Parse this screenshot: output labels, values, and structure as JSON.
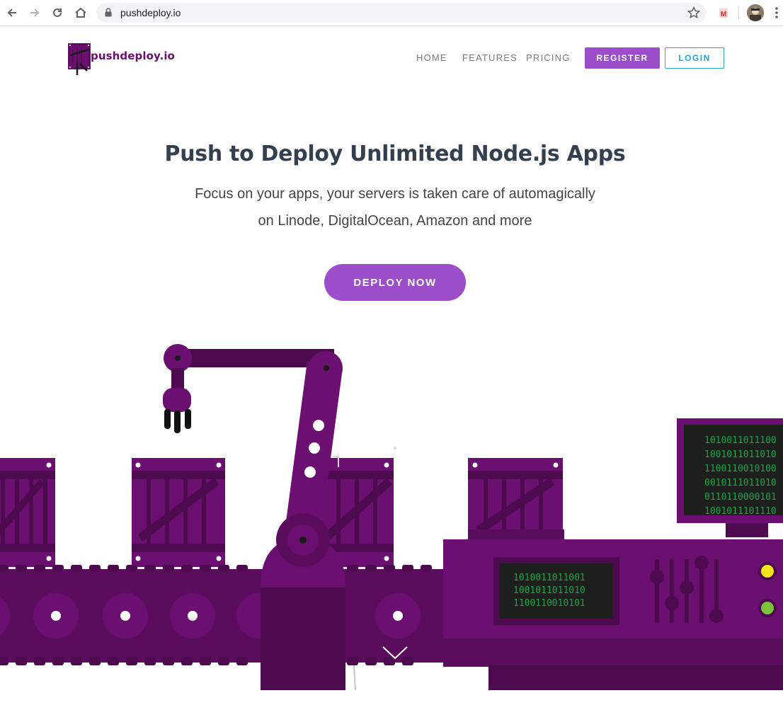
{
  "browser": {
    "url": "pushdeploy.io"
  },
  "header": {
    "logo_text": "pushdeploy.io",
    "nav": [
      {
        "label": "HOME"
      },
      {
        "label": "FEATURES"
      },
      {
        "label": "PRICING"
      }
    ],
    "register_label": "REGISTER",
    "login_label": "LOGIN"
  },
  "hero": {
    "title": "Push to Deploy Unlimited Node.js Apps",
    "subtitle_line1": "Focus on your apps, your servers is taken care of automagically",
    "subtitle_line2": "on Linode, DigitalOcean, Amazon and more",
    "cta_label": "DEPLOY NOW"
  },
  "illustration": {
    "monitor_lines": [
      "1010011011100",
      "1001011011010",
      "1100110010100",
      "0010111011010",
      "0110110000101",
      "1001011101110"
    ],
    "machine_lines": [
      "1010011011001",
      "1001011011010",
      "1100110010101"
    ],
    "colors": {
      "purple": "#6b1070",
      "purple_dark": "#4e0a4f",
      "purple_mid": "#5a0d5d",
      "accent": "#9b4dca",
      "screen_green": "#1fa34a",
      "light_yellow": "#f2e51a",
      "light_green": "#7dc43d"
    }
  }
}
